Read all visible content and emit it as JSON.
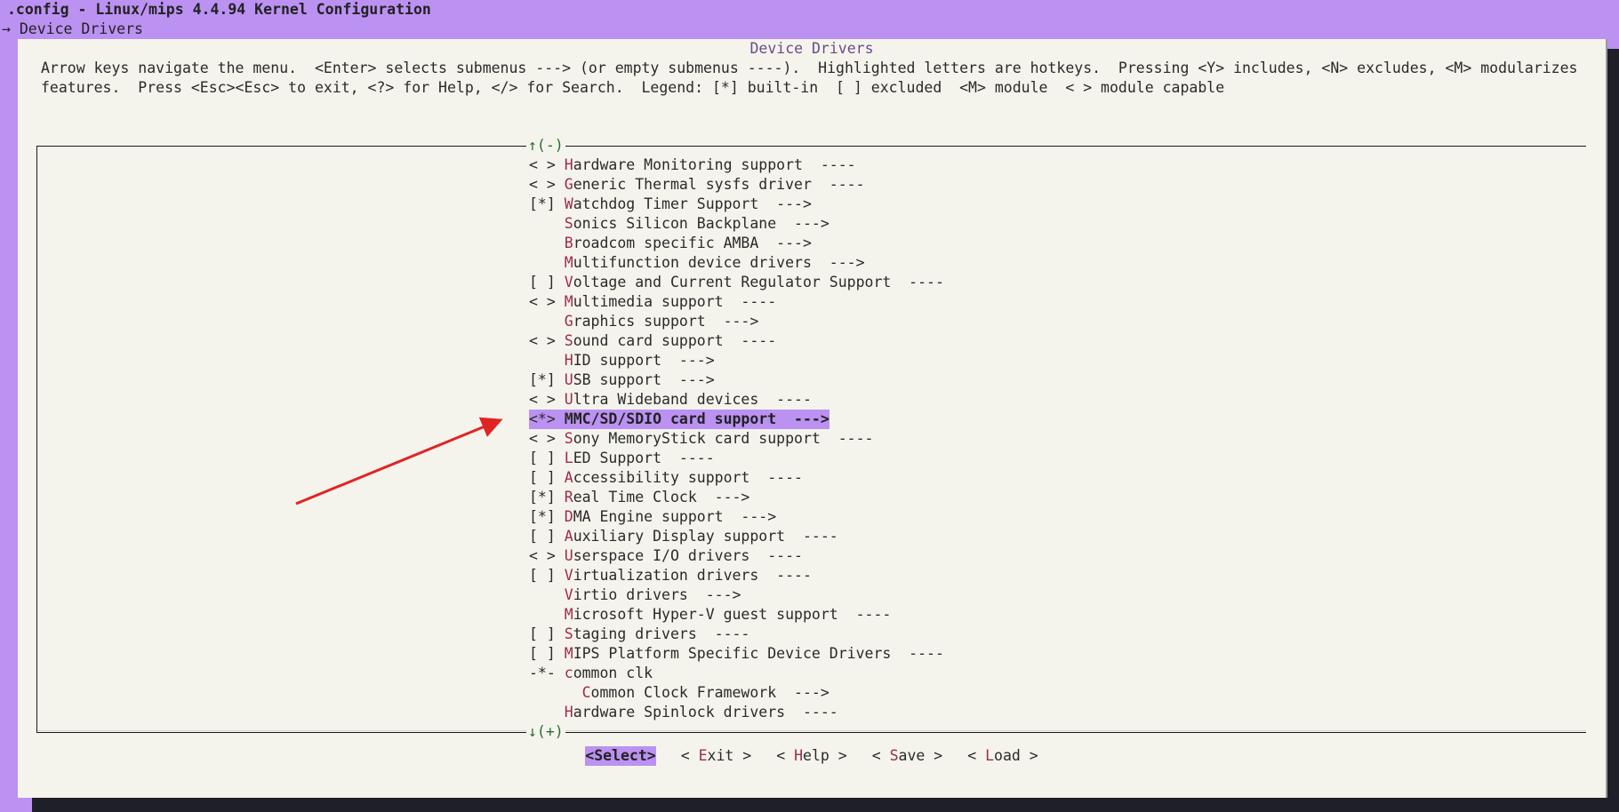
{
  "window": {
    "title": ".config - Linux/mips 4.4.94 Kernel Configuration",
    "breadcrumb": "→ Device Drivers"
  },
  "dialog": {
    "title": "Device Drivers",
    "help_text": "Arrow keys navigate the menu.  <Enter> selects submenus ---> (or empty submenus ----).  Highlighted letters are hotkeys.  Pressing <Y> includes, <N> excludes, <M> modularizes features.  Press <Esc><Esc> to exit, <?> for Help, </> for Search.  Legend: [*] built-in  [ ] excluded  <M> module  < > module capable",
    "scroll_up": "↑(-)",
    "scroll_down": "↓(+)"
  },
  "menu": {
    "items": [
      {
        "prefix": "< > ",
        "hotkey": "H",
        "rest": "ardware Monitoring support  ----"
      },
      {
        "prefix": "< > ",
        "hotkey": "G",
        "rest": "eneric Thermal sysfs driver  ----"
      },
      {
        "prefix": "[*] ",
        "hotkey": "W",
        "rest": "atchdog Timer Support  --->"
      },
      {
        "prefix": "    ",
        "hotkey": "S",
        "rest": "onics Silicon Backplane  --->"
      },
      {
        "prefix": "    ",
        "hotkey": "B",
        "rest": "roadcom specific AMBA  --->"
      },
      {
        "prefix": "    ",
        "hotkey": "M",
        "rest": "ultifunction device drivers  --->"
      },
      {
        "prefix": "[ ] ",
        "hotkey": "V",
        "rest": "oltage and Current Regulator Support  ----"
      },
      {
        "prefix": "< > ",
        "hotkey": "M",
        "rest": "ultimedia support  ----"
      },
      {
        "prefix": "    ",
        "hotkey": "G",
        "rest": "raphics support  --->"
      },
      {
        "prefix": "< > ",
        "hotkey": "S",
        "rest": "ound card support  ----"
      },
      {
        "prefix": "    ",
        "hotkey": "H",
        "rest": "ID support  --->"
      },
      {
        "prefix": "[*] ",
        "hotkey": "U",
        "rest": "SB support  --->"
      },
      {
        "prefix": "< > ",
        "hotkey": "U",
        "rest": "ltra Wideband devices  ----"
      },
      {
        "prefix": "<*> ",
        "hotkey": "M",
        "rest": "MC/SD/SDIO card support  --->",
        "selected": true
      },
      {
        "prefix": "< > ",
        "hotkey": "S",
        "rest": "ony MemoryStick card support  ----"
      },
      {
        "prefix": "[ ] ",
        "hotkey": "L",
        "rest": "ED Support  ----"
      },
      {
        "prefix": "[ ] ",
        "hotkey": "A",
        "rest": "ccessibility support  ----"
      },
      {
        "prefix": "[*] ",
        "hotkey": "R",
        "rest": "eal Time Clock  --->"
      },
      {
        "prefix": "[*] ",
        "hotkey": "D",
        "rest": "MA Engine support  --->"
      },
      {
        "prefix": "[ ] ",
        "hotkey": "A",
        "rest": "uxiliary Display support  ----"
      },
      {
        "prefix": "< > ",
        "hotkey": "U",
        "rest": "serspace I/O drivers  ----"
      },
      {
        "prefix": "[ ] ",
        "hotkey": "V",
        "rest": "irtualization drivers  ----"
      },
      {
        "prefix": "    ",
        "hotkey": "V",
        "rest": "irtio drivers  --->"
      },
      {
        "prefix": "    ",
        "hotkey": "M",
        "rest": "icrosoft Hyper-V guest support  ----"
      },
      {
        "prefix": "[ ] ",
        "hotkey": "S",
        "rest": "taging drivers  ----"
      },
      {
        "prefix": "[ ] ",
        "hotkey": "M",
        "rest": "IPS Platform Specific Device Drivers  ----"
      },
      {
        "prefix": "-*- ",
        "hotkey": "c",
        "rest": "ommon clk"
      },
      {
        "prefix": "      ",
        "hotkey": "C",
        "rest": "ommon Clock Framework  --->"
      },
      {
        "prefix": "    ",
        "hotkey": "H",
        "rest": "ardware Spinlock drivers  ----"
      }
    ]
  },
  "buttons": [
    {
      "open": "<",
      "hotkey": "S",
      "rest": "elect",
      "close": ">",
      "active": true
    },
    {
      "open": "< ",
      "hotkey": "E",
      "rest": "xit",
      "close": " >",
      "active": false
    },
    {
      "open": "< ",
      "hotkey": "H",
      "rest": "elp",
      "close": " >",
      "active": false
    },
    {
      "open": "< ",
      "hotkey": "S",
      "rest": "ave",
      "close": " >",
      "active": false
    },
    {
      "open": "< ",
      "hotkey": "L",
      "rest": "oad",
      "close": " >",
      "active": false
    }
  ],
  "colors": {
    "background": "#bb92f2",
    "dialog": "#f4f4ec",
    "hotkey": "#a02a4a",
    "highlight": "#bb92f2",
    "annotation_arrow": "#e02424"
  }
}
